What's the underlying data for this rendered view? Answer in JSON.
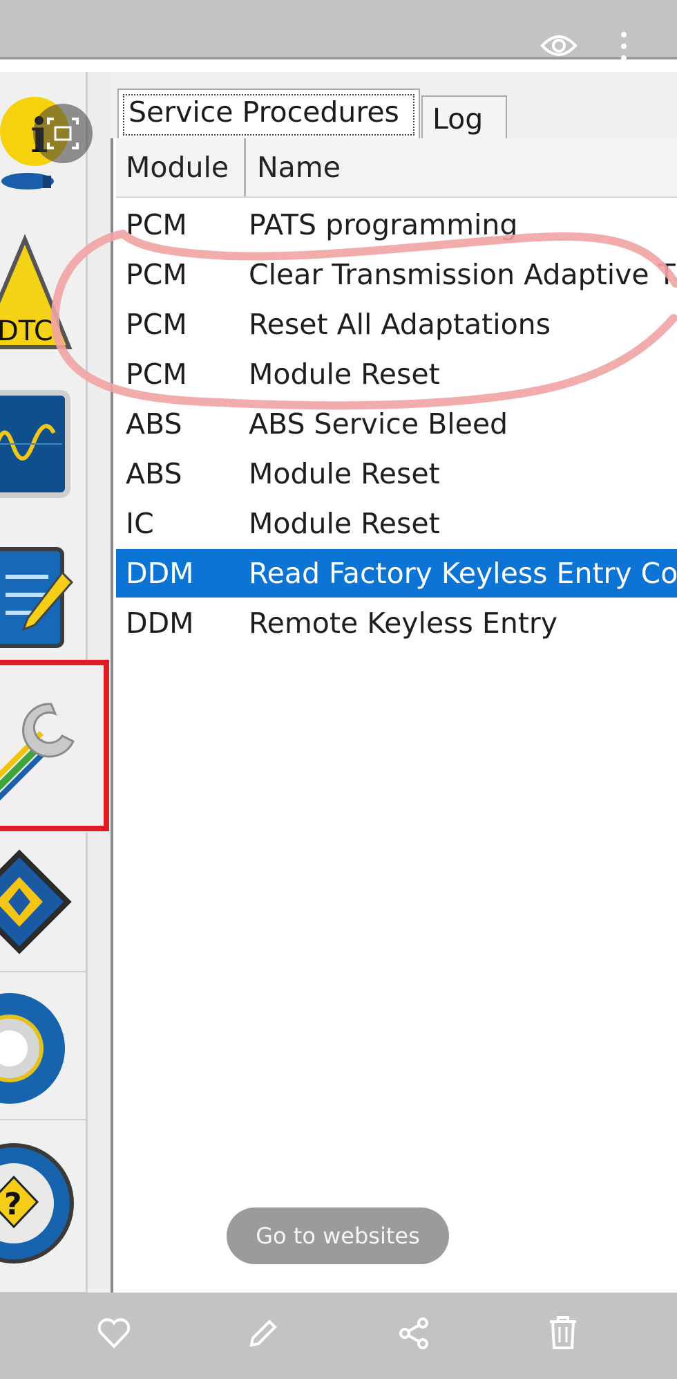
{
  "tabs": [
    {
      "label": "Service Procedures",
      "active": true
    },
    {
      "label": "Log",
      "active": false
    }
  ],
  "table": {
    "headers": [
      "Module",
      "Name"
    ],
    "rows": [
      {
        "module": "PCM",
        "name": "PATS programming"
      },
      {
        "module": "PCM",
        "name": "Clear Transmission Adaptive T"
      },
      {
        "module": "PCM",
        "name": "Reset All Adaptations"
      },
      {
        "module": "PCM",
        "name": "Module Reset"
      },
      {
        "module": "ABS",
        "name": "ABS Service Bleed"
      },
      {
        "module": "ABS",
        "name": "Module Reset"
      },
      {
        "module": "IC",
        "name": "Module Reset"
      },
      {
        "module": "DDM",
        "name": "Read Factory Keyless Entry Co",
        "selected": true
      },
      {
        "module": "DDM",
        "name": "Remote Keyless Entry"
      }
    ]
  },
  "sidebar": {
    "items": [
      {
        "icon": "info-icon"
      },
      {
        "icon": "dtc-warning-icon",
        "label": "DTC"
      },
      {
        "icon": "oscilloscope-icon"
      },
      {
        "icon": "checklist-pencil-icon"
      },
      {
        "icon": "wrench-icon",
        "highlighted": true
      },
      {
        "icon": "chip-icon"
      },
      {
        "icon": "gear-icon"
      },
      {
        "icon": "help-steering-icon",
        "label": "?"
      }
    ]
  },
  "viewer": {
    "go_to_websites": "Go to websites",
    "top_icons": [
      "eye-icon",
      "more-vert-icon",
      "image-search-icon"
    ],
    "bottom_actions": [
      "heart-icon",
      "edit-icon",
      "share-icon",
      "delete-icon"
    ]
  },
  "colors": {
    "selection": "#0b74d5",
    "annotation_circle": "#f2a3a3",
    "highlight_box": "#e01b24",
    "viewer_bar": "#c3c3c3"
  }
}
